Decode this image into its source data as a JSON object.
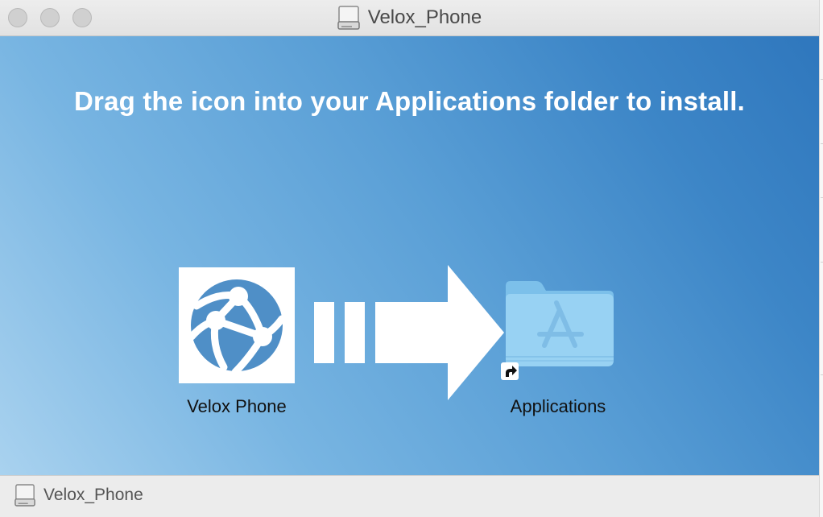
{
  "window": {
    "title": "Velox_Phone",
    "title_icon": "disk-image-icon",
    "traffic_lights": [
      "close",
      "minimize",
      "zoom"
    ]
  },
  "installer": {
    "instruction": "Drag the icon into your Applications folder to install.",
    "app_icon": "globe-network-icon",
    "app_label": "Velox Phone",
    "arrow_icon": "right-arrow-icon",
    "target_icon": "applications-folder-icon",
    "target_label": "Applications",
    "alias_icon": "alias-arrow-icon"
  },
  "statusbar": {
    "icon": "disk-image-icon",
    "label": "Velox_Phone"
  },
  "colors": {
    "background_light": "#a9d2ef",
    "background_dark": "#2f77bd",
    "app_blue": "#4f8fc7",
    "folder_blue": "#8fcbf0"
  }
}
